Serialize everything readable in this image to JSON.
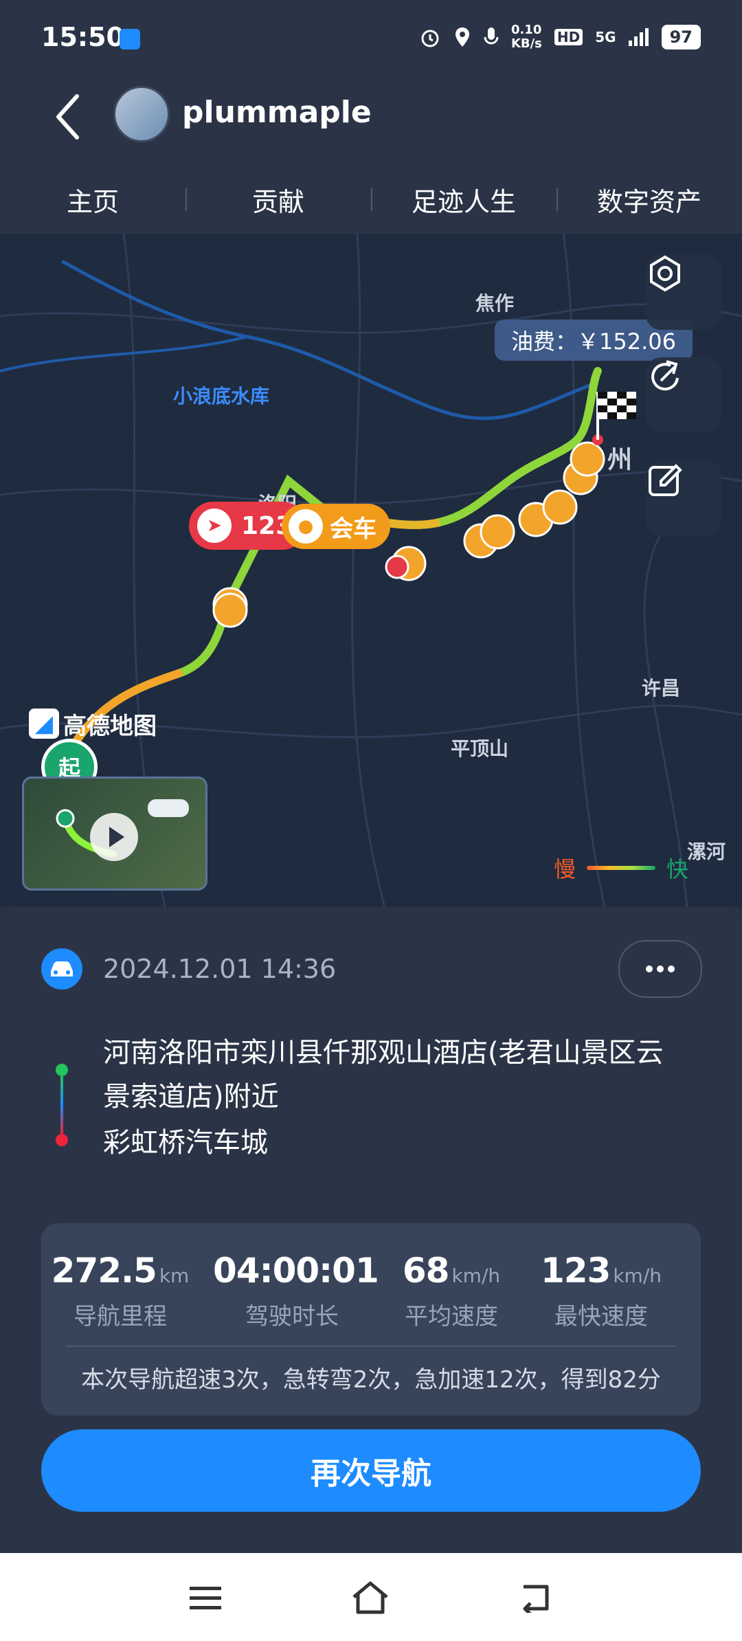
{
  "status_bar": {
    "time": "15:50",
    "speed_top": "0.10",
    "speed_unit": "KB/s",
    "hd": "HD",
    "network": "5G",
    "battery": "97",
    "icons": [
      "alarm-icon",
      "location-icon",
      "mic-icon",
      "signal-icon"
    ]
  },
  "header": {
    "username": "plummaple"
  },
  "tabs": [
    "主页",
    "贡献",
    "足迹人生",
    "数字资产"
  ],
  "map": {
    "labels": {
      "jiaozuo": "焦作",
      "reservoir": "小浪底水库",
      "luoyang": "洛阳",
      "zhou": "州",
      "xuchang": "许昌",
      "pingdingshan": "平顶山",
      "luohe": "漯河"
    },
    "fuel": "油费：￥152.06",
    "max_speed_pill": "123",
    "meet_car_pill": "会车",
    "logo": "高德地图",
    "start_marker": "起",
    "speed_legend": {
      "slow": "慢",
      "fast": "快"
    }
  },
  "trip": {
    "datetime": "2024.12.01 14:36",
    "origin": "河南洛阳市栾川县仟那观山酒店(老君山景区云景索道店)附近",
    "destination": "彩虹桥汽车城"
  },
  "stats": {
    "distance": {
      "value": "272.5",
      "unit": "km",
      "label": "导航里程"
    },
    "duration": {
      "value": "04:00:01",
      "unit": "",
      "label": "驾驶时长"
    },
    "avg_speed": {
      "value": "68",
      "unit": "km/h",
      "label": "平均速度"
    },
    "max_speed": {
      "value": "123",
      "unit": "km/h",
      "label": "最快速度"
    },
    "summary": "本次导航超速3次，急转弯2次，急加速12次，得到82分"
  },
  "nav_button": "再次导航",
  "colors": {
    "accent": "#1e8bff",
    "background": "#2b3446",
    "slow": "#f25a2b",
    "fast": "#1aa56c"
  }
}
